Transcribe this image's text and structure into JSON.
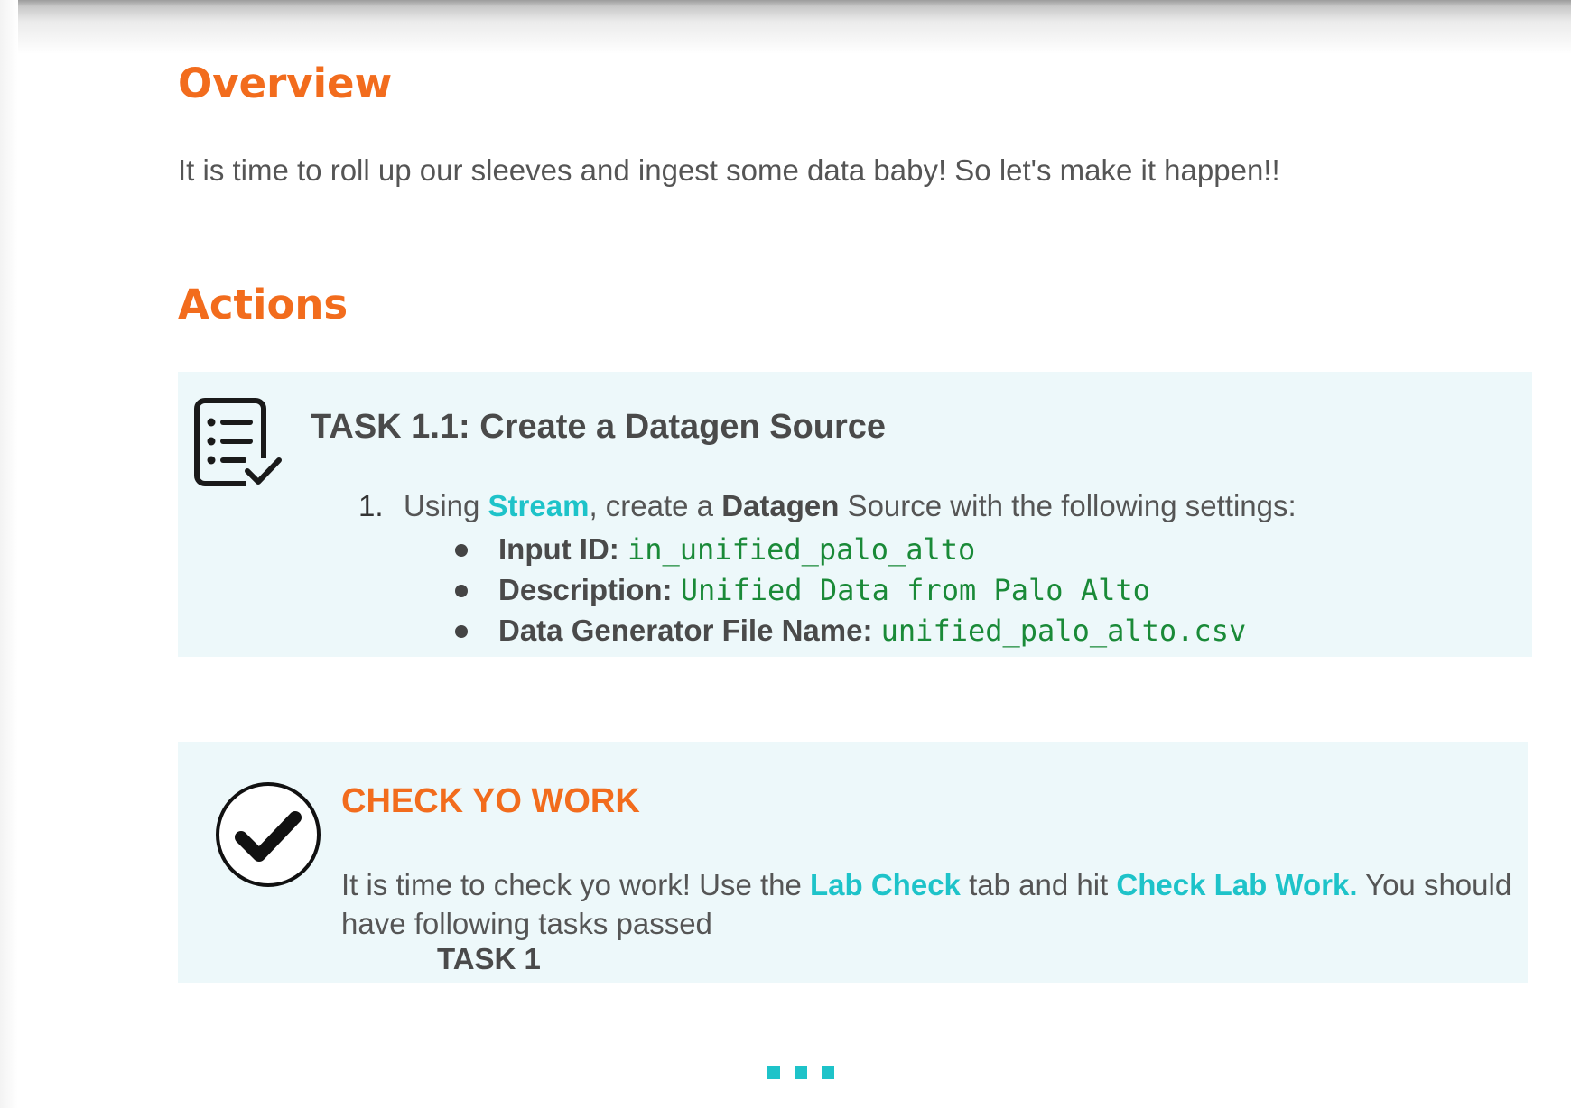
{
  "overview": {
    "heading": "Overview",
    "text": "It is time to roll up our sleeves and ingest some data baby! So let's make it happen!!"
  },
  "actions": {
    "heading": "Actions"
  },
  "task": {
    "icon": "checklist-icon",
    "title": "TASK 1.1: Create a Datagen Source",
    "step": {
      "number": "1.",
      "pre": "Using ",
      "stream": "Stream",
      "mid": ", create a ",
      "datagen": "Datagen",
      "post": " Source with the following settings:"
    },
    "settings": [
      {
        "label": "Input ID:",
        "value": "in_unified_palo_alto"
      },
      {
        "label": "Description:",
        "value": "Unified Data from Palo Alto"
      },
      {
        "label": "Data Generator File Name:",
        "value": "unified_palo_alto.csv"
      }
    ]
  },
  "check": {
    "icon": "checkmark-circle-icon",
    "title": "CHECK YO WORK",
    "text_pre": "It is time to check yo work!  Use the ",
    "lab_check": "Lab Check",
    "text_mid": " tab and hit ",
    "check_lab_work": "Check Lab Work.",
    "text_post": "  You should have following tasks passed",
    "task_passed": "TASK 1"
  },
  "colors": {
    "heading_orange": "#f26c1d",
    "highlight_teal": "#1ec3c9",
    "code_green": "#1a8a38",
    "panel_bg": "#edf8fa"
  },
  "more_indicator": "more-dots-icon"
}
